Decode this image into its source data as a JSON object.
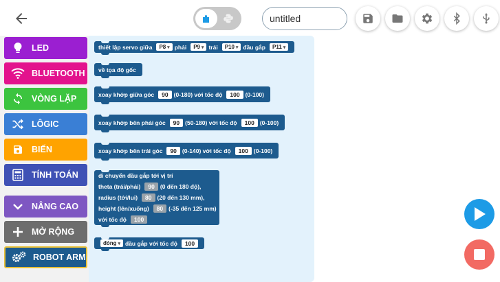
{
  "topbar": {
    "project_name": "untitled",
    "icons": {
      "back": "arrow-left-icon",
      "blocks_mode": "puzzle-piece-icon",
      "python_mode": "python-icon",
      "save": "save-icon",
      "open": "folder-icon",
      "settings": "gear-icon",
      "bluetooth": "bluetooth-icon",
      "usb": "usb-icon"
    }
  },
  "sidebar": {
    "items": [
      {
        "label": "LED",
        "color": "#9b1fd1",
        "icon": "lightbulb-icon"
      },
      {
        "label": "BLUETOOTH",
        "color": "#e3138d",
        "icon": "wifi-icon"
      },
      {
        "label": "VÒNG LẶP",
        "color": "#3cc43f",
        "icon": "loop-icon"
      },
      {
        "label": "LÔGIC",
        "color": "#3a7fd5",
        "icon": "shuffle-icon"
      },
      {
        "label": "BIẾN",
        "color": "#ffa300",
        "icon": "save-icon"
      },
      {
        "label": "TÍNH TOÁN",
        "color": "#3f51b5",
        "icon": "calculator-icon"
      },
      {
        "label": "NÂNG CAO",
        "color": "#7e57c2",
        "icon": "chevron-down-icon"
      },
      {
        "label": "MỞ RỘNG",
        "color": "#6d6d6d",
        "icon": "plus-icon"
      },
      {
        "label": "ROBOT ARM",
        "color": "#1d5b8e",
        "icon": "gears-icon"
      }
    ]
  },
  "blocks": {
    "servo": {
      "text1": "thiết lập servo giữa",
      "opt1": "P8",
      "text2": "phải",
      "opt2": "P9",
      "text3": "trái",
      "opt3": "P10",
      "text4": "đầu gắp",
      "opt4": "P11"
    },
    "home": {
      "text": "về tọa độ gốc"
    },
    "rotate_middle": {
      "text1": "xoay khớp giữa góc",
      "angle": "90",
      "range": "(0-180) với tốc độ",
      "speed": "100",
      "speed_range": "(0-100)"
    },
    "rotate_right": {
      "text1": "xoay khớp bên phải góc",
      "angle": "90",
      "range": "(50-180) với tốc độ",
      "speed": "100",
      "speed_range": "(0-100)"
    },
    "rotate_left": {
      "text1": "xoay khớp bên trái góc",
      "angle": "90",
      "range": "(0-140) với tốc độ",
      "speed": "100",
      "speed_range": "(0-100)"
    },
    "move": {
      "line1": "di chuyển đầu gắp tới vị trí",
      "theta_label": "theta (trái/phải)",
      "theta_value": "90",
      "theta_range": "(0 đến 180 độ),",
      "radius_label": "radius (tới/lui)",
      "radius_value": "80",
      "radius_range": "(20 đến 130 mm),",
      "height_label": "height (lên/xuống)",
      "height_value": "80",
      "height_range": "(-35 đến 125 mm)",
      "speed_label": "với tốc độ",
      "speed_value": "100"
    },
    "gripper": {
      "option": "đóng",
      "text": "đầu gắp với tốc độ",
      "speed": "100"
    }
  },
  "controls": {
    "run_icon": "play-icon",
    "stop_icon": "stop-icon"
  }
}
